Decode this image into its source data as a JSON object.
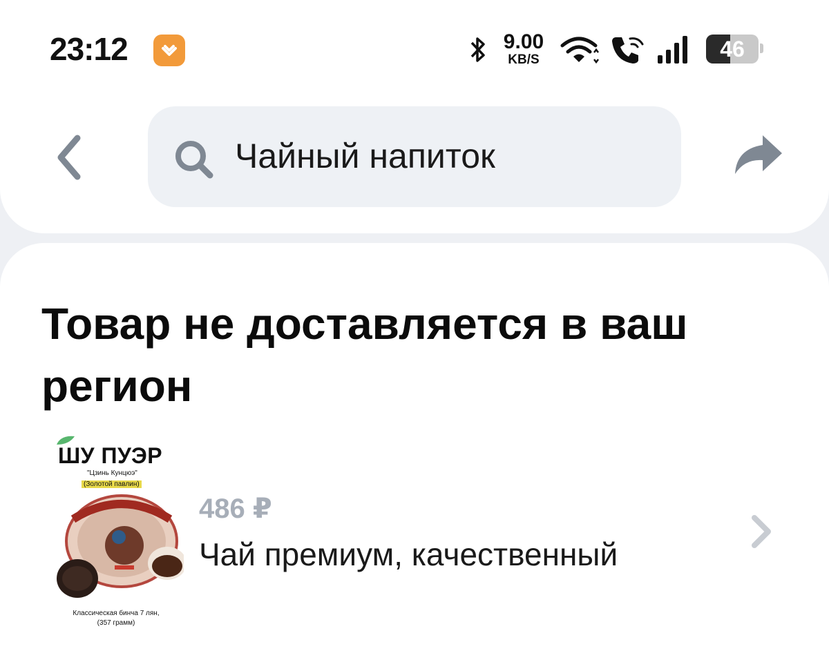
{
  "status_bar": {
    "time": "23:12",
    "net_speed": "9.00",
    "net_unit": "KB/S",
    "battery_level": "46",
    "battery_fraction": 0.46,
    "icons": [
      "app-badge-icon",
      "bluetooth-icon",
      "wifi-icon",
      "wifi-call-icon",
      "signal-icon",
      "battery-icon"
    ]
  },
  "header": {
    "search_query": "Чайный напиток",
    "back_icon": "chevron-left-icon",
    "search_icon": "search-icon",
    "share_icon": "share-arrow-icon"
  },
  "main": {
    "heading": "Товар не доставляется в ваш регион",
    "product": {
      "image_title": "ШУ ПУЭР",
      "image_sub1": "\"Цзинь Кунцюэ\"",
      "image_sub2": "(Золотой павлин)",
      "image_caption_1": "Классическая бинча 7 лян,",
      "image_caption_2": "(357 грамм)",
      "price": "486 ₽",
      "name": "Чай премиум, качественный",
      "chevron_icon": "chevron-right-icon"
    }
  },
  "colors": {
    "background": "#eef0f4",
    "card": "#ffffff",
    "search_bg": "#eef1f5",
    "icon_gray": "#7f8893",
    "price_gray": "#a7aeb8",
    "app_badge": "#f29a3a"
  }
}
